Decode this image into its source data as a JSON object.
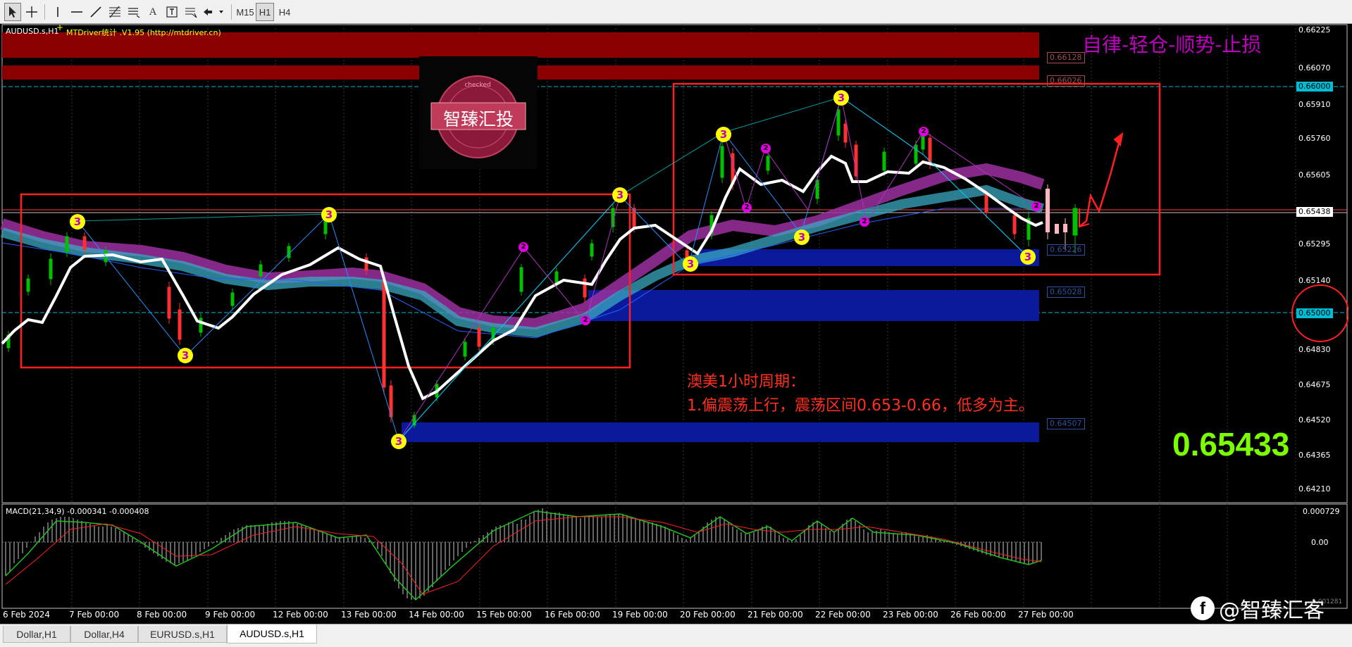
{
  "toolbar": {
    "timeframes": [
      "M15",
      "H1",
      "H4"
    ],
    "active_timeframe": "H1",
    "tools": [
      "cursor-icon",
      "crosshair-icon",
      "vertical-line-icon",
      "horizontal-line-icon",
      "trendline-icon",
      "fibonacci-icon",
      "channel-icon",
      "text-icon",
      "text-label-icon",
      "fibo-fan-icon",
      "arrow-shapes-icon"
    ],
    "text_tool_glyph": "A"
  },
  "chart": {
    "header": "AUDUSD.s,H1",
    "indicator_label": "MTDriver统计 .V1.95 (http://mtdriver.cn)",
    "slogan": "自律-轻仓-顺势-止损",
    "big_price": "0.65433",
    "analysis_line1": "澳美1小时周期：",
    "analysis_line2": "1.偏震荡上行，震荡区间0.653-0.66，低多为主。",
    "logo_text": "智臻汇投",
    "stamp_ring_text": "checked",
    "watermark": "@智臻汇客",
    "price_axis": [
      "0.66225",
      "0.66070",
      "0.65910",
      "0.65760",
      "0.65605",
      "0.65295",
      "0.65140",
      "0.64830",
      "0.64675",
      "0.64520",
      "0.64365",
      "0.64210"
    ],
    "price_boxes": {
      "high_line": "0.66000",
      "current": "0.65438",
      "circled": "0.65000",
      "zone_a": "0.66128",
      "zone_b": "0.66026",
      "zone_c": "0.65226",
      "zone_d": "0.65028",
      "zone_e": "0.64507"
    },
    "time_axis": [
      "6 Feb 2024",
      "7 Feb 00:00",
      "8 Feb 00:00",
      "9 Feb 00:00",
      "12 Feb 00:00",
      "13 Feb 00:00",
      "14 Feb 00:00",
      "15 Feb 00:00",
      "16 Feb 00:00",
      "19 Feb 00:00",
      "20 Feb 00:00",
      "21 Feb 00:00",
      "22 Feb 00:00",
      "23 Feb 00:00",
      "26 Feb 00:00",
      "27 Feb 00:00"
    ],
    "wave_labels": [
      "3",
      "2"
    ]
  },
  "macd": {
    "label": "MACD(21,34,9) -0.000341 -0.000408",
    "axis": [
      "0.000729",
      "0.00"
    ],
    "bottom_axis_value": "-0.001281"
  },
  "tabs": [
    "Dollar,H1",
    "Dollar,H4",
    "EURUSD.s,H1",
    "AUDUSD.s,H1"
  ],
  "active_tab": "AUDUSD.s,H1",
  "colors": {
    "bull_candle": "#00c000",
    "bear_candle": "#ff3030",
    "resistance_zone": "#8b0000",
    "support_zone": "#0a1a9a",
    "box_outline": "#ff2020",
    "slogan": "#c000c0",
    "big_price": "#7cfc00",
    "analysis_text": "#ff3020",
    "wave3_fill": "#ffff00",
    "wave2_fill": "#e000e0"
  }
}
